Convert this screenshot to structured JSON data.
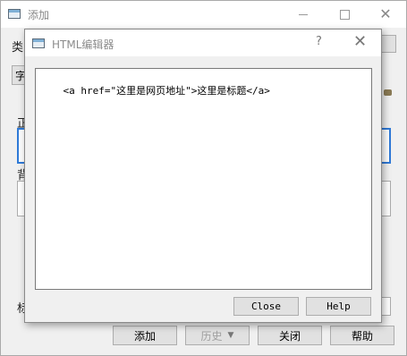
{
  "main_window": {
    "title": "添加",
    "partial_labels": {
      "type": "类",
      "body": "正",
      "background": "背",
      "tag": "标"
    },
    "partial_button": "字",
    "buttons": {
      "add": "添加",
      "history": "历史",
      "close": "关闭",
      "help": "帮助"
    },
    "history_arrow": "▼"
  },
  "dialog": {
    "title": "HTML编辑器",
    "help_glyph": "?",
    "close_glyph": "✕",
    "editor_content": "<a href=\"这里是网页地址\">这里是标题</a>",
    "buttons": {
      "close": "Close",
      "help": "Help"
    }
  }
}
